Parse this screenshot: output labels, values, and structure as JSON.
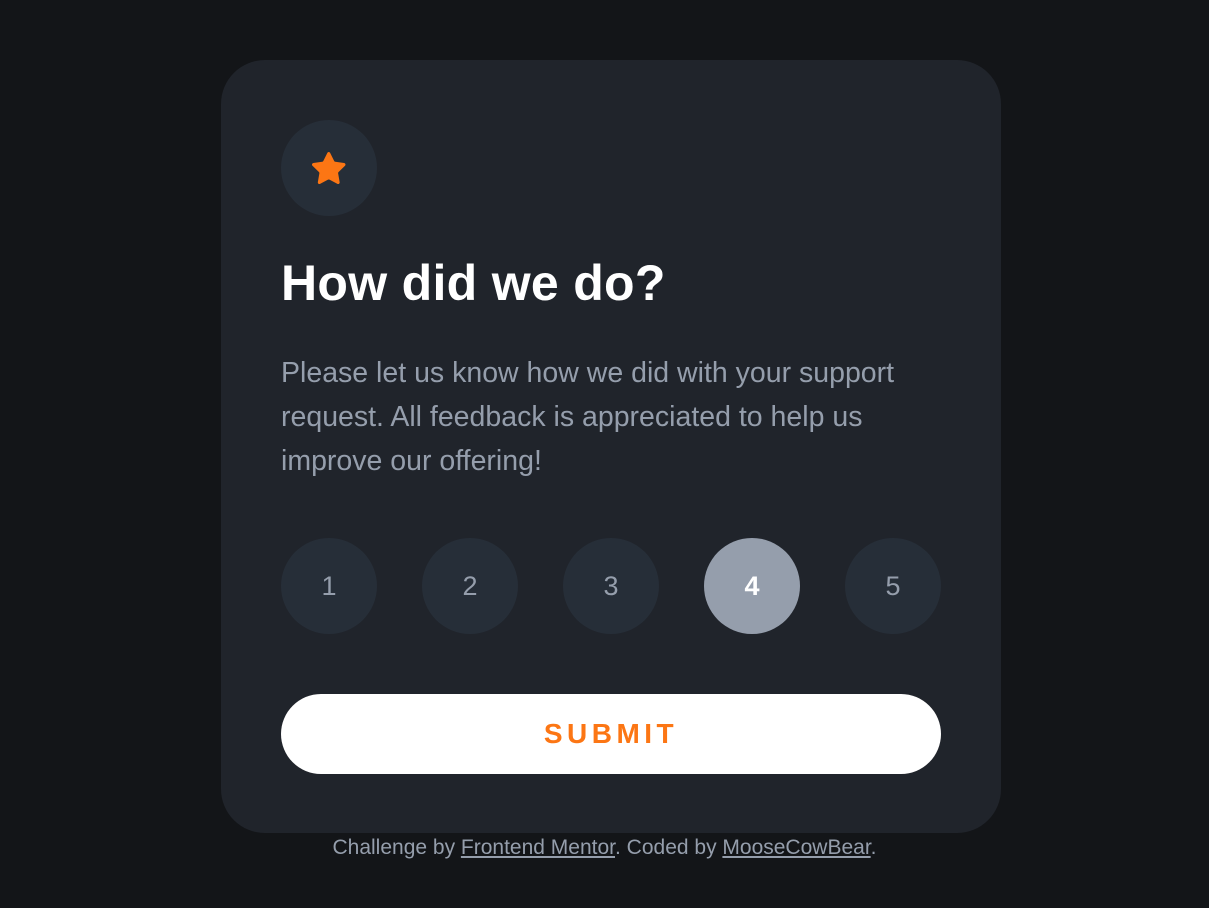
{
  "card": {
    "icon": "star-icon",
    "title": "How did we do?",
    "description": "Please let us know how we did with your support request. All feedback is appreciated to help us improve our offering!",
    "ratings": [
      "1",
      "2",
      "3",
      "4",
      "5"
    ],
    "selected_rating": "4",
    "submit_label": "SUBMIT"
  },
  "footer": {
    "prefix": "Challenge by ",
    "link1": "Frontend Mentor",
    "middle": ". Coded by ",
    "link2": "MooseCowBear",
    "suffix": "."
  },
  "colors": {
    "background": "#131518",
    "card": "#20242b",
    "circle": "#262e38",
    "accent": "#fc7614",
    "selected": "#959eac",
    "text_muted": "#959eac",
    "white": "#ffffff"
  }
}
